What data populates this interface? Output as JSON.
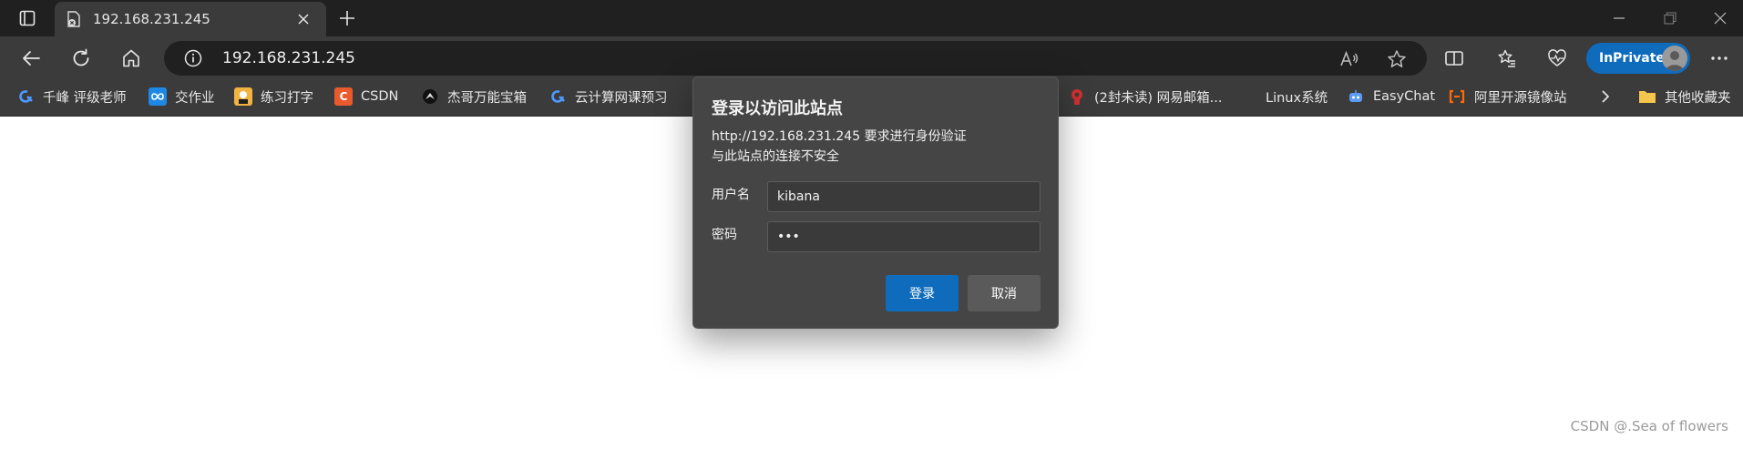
{
  "tab": {
    "title": "192.168.231.245"
  },
  "address_bar": {
    "url": "192.168.231.245"
  },
  "inprivate": {
    "label": "InPrivate"
  },
  "favorites": [
    {
      "label": "千峰 评级老师",
      "icon": "refresh-q-icon",
      "color": "#4c9aff"
    },
    {
      "label": "交作业",
      "icon": "infinity-icon",
      "color": "#1e88e5"
    },
    {
      "label": "练习打字",
      "icon": "typing-avatar-icon",
      "color": "#f2b441"
    },
    {
      "label": "CSDN",
      "icon": "csdn-icon",
      "color": "#e95b2c"
    },
    {
      "label": "杰哥万能宝箱",
      "icon": "bird-icon",
      "color": "#e0e0e0"
    },
    {
      "label": "云计算网课预习",
      "icon": "refresh-q-icon",
      "color": "#4c9aff"
    },
    {
      "label": "(2封未读) 网易邮箱...",
      "icon": "netease-mail-icon",
      "color": "#d32f2f"
    },
    {
      "label": "Linux系统",
      "icon": "",
      "color": ""
    },
    {
      "label": "EasyChat",
      "icon": "robot-icon",
      "color": "#5b9bf3"
    },
    {
      "label": "阿里开源镜像站",
      "icon": "aliyun-icon",
      "color": "#ff6a00"
    },
    {
      "label": "其他收藏夹",
      "icon": "folder-icon",
      "color": "#f4c64e"
    }
  ],
  "dialog": {
    "title": "登录以访问此站点",
    "message_line1": "http://192.168.231.245 要求进行身份验证",
    "message_line2": "与此站点的连接不安全",
    "username_label": "用户名",
    "username_value": "kibana",
    "password_label": "密码",
    "password_value": "•••",
    "login_label": "登录",
    "cancel_label": "取消"
  },
  "watermark": "CSDN @.Sea of flowers"
}
